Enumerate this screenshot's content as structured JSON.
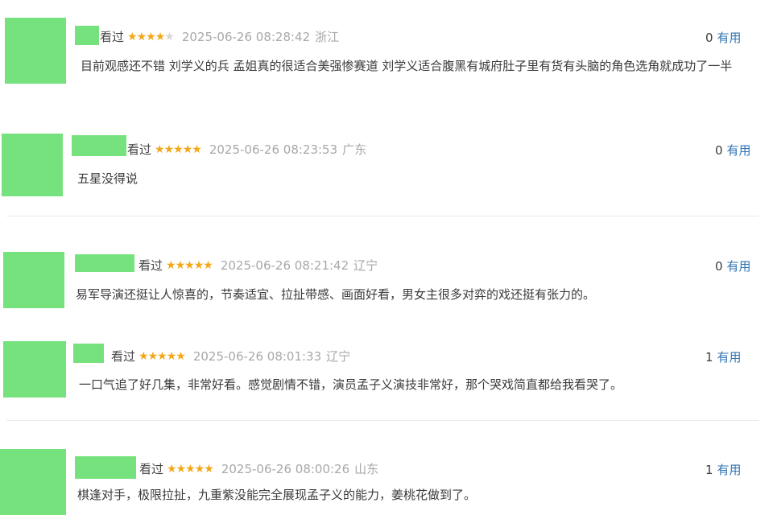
{
  "reviews": [
    {
      "status": "看过",
      "rating": 4,
      "time": "2025-06-26 08:28:42",
      "region": "浙江",
      "useful_count": "0",
      "useful_label": "有用",
      "comment": "目前观感还不错 刘学义的兵 孟姐真的很适合美强惨赛道 刘学义适合腹黑有城府肚子里有货有头脑的角色选角就成功了一半"
    },
    {
      "status": "看过",
      "rating": 5,
      "time": "2025-06-26 08:23:53",
      "region": "广东",
      "useful_count": "0",
      "useful_label": "有用",
      "comment": "五星没得说"
    },
    {
      "status": "看过",
      "rating": 5,
      "time": "2025-06-26 08:21:42",
      "region": "辽宁",
      "useful_count": "0",
      "useful_label": "有用",
      "comment": "易军导演还挺让人惊喜的，节奏适宜、拉扯带感、画面好看，男女主很多对弈的戏还挺有张力的。"
    },
    {
      "status": "看过",
      "rating": 5,
      "time": "2025-06-26 08:01:33",
      "region": "辽宁",
      "useful_count": "1",
      "useful_label": "有用",
      "comment": "一口气追了好几集，非常好看。感觉剧情不错，演员孟子义演技非常好，那个哭戏简直都给我看哭了。"
    },
    {
      "status": "看过",
      "rating": 5,
      "time": "2025-06-26 08:00:26",
      "region": "山东",
      "useful_count": "1",
      "useful_label": "有用",
      "comment": "棋逢对手，极限拉扯，九重紫没能完全展现孟子义的能力，姜桃花做到了。"
    }
  ]
}
